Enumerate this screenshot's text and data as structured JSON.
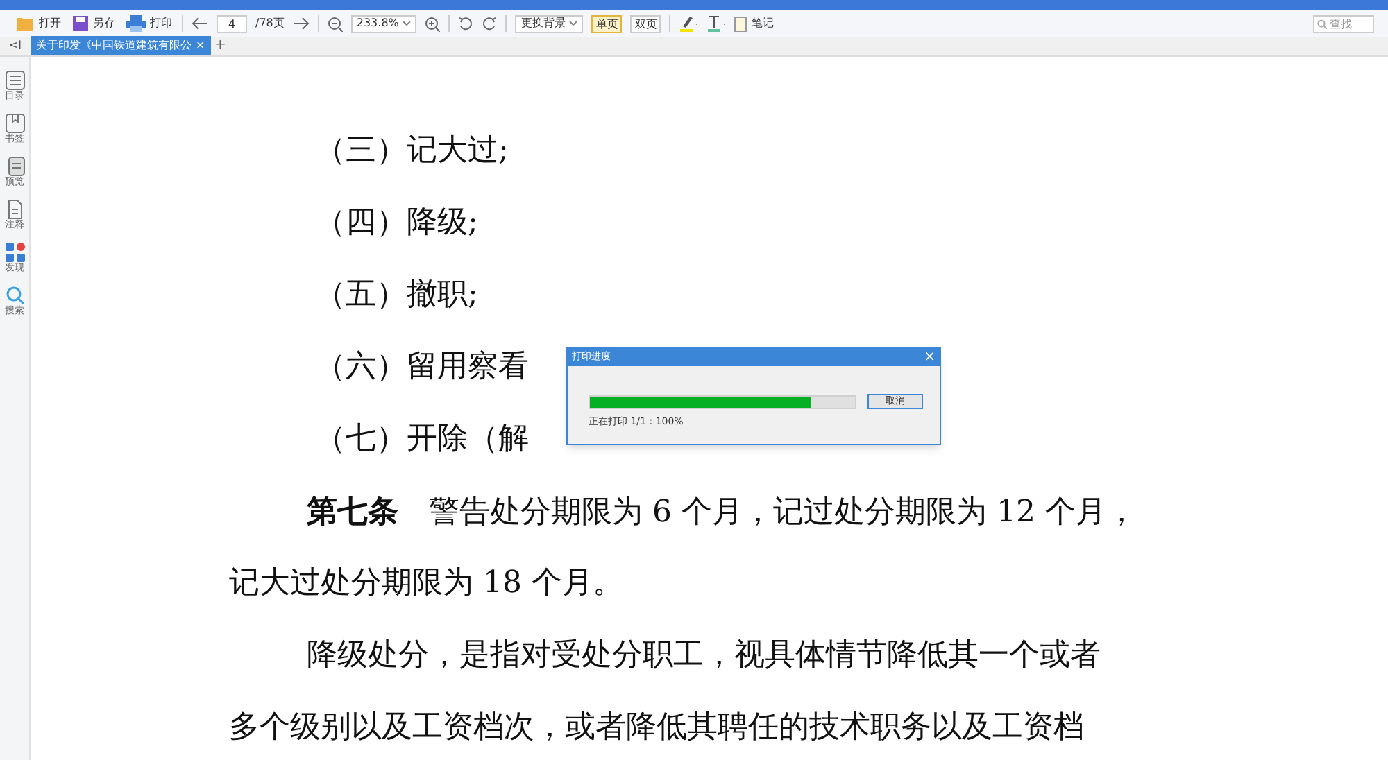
{
  "toolbar": {
    "items": [
      {
        "kind": "open",
        "label": "打开"
      },
      {
        "kind": "save",
        "label": "另存"
      },
      {
        "kind": "print",
        "label": "打印"
      }
    ],
    "page_input": "4",
    "page_total": "/78页",
    "zoom": "233.8%",
    "background": "更换背景",
    "view_modes": [
      {
        "label": "单页",
        "selected": true
      },
      {
        "label": "双页",
        "selected": false
      }
    ],
    "note": "笔记",
    "search": {
      "placeholder": "查找"
    }
  },
  "tabs": [
    {
      "label": "关于印发《中国铁道建筑有限公",
      "selected": true,
      "close": "×"
    }
  ],
  "new_tab": "+",
  "collapse": "<I",
  "sidebar": {
    "items": [
      {
        "kind": "toc",
        "label": "目录"
      },
      {
        "kind": "bookmark",
        "label": "书签"
      },
      {
        "kind": "preview",
        "label": "预览"
      },
      {
        "kind": "note",
        "label": "注释"
      },
      {
        "kind": "apps",
        "label": "发现"
      },
      {
        "kind": "search",
        "label": "搜索"
      }
    ]
  },
  "document": {
    "lines": [
      {
        "kind": "item",
        "text": "（三）记大过;"
      },
      {
        "kind": "item",
        "text": "（四）降级;"
      },
      {
        "kind": "item",
        "text": "（五）撤职;"
      },
      {
        "kind": "item",
        "text": "（六）留用察看"
      },
      {
        "kind": "item",
        "text": "（七）开除（解"
      },
      {
        "kind": "para",
        "text": "**第七条**　警告处分期限为 6 个月，记过处分期限为 12 个月，"
      },
      {
        "kind": "cont",
        "text": "记大过处分期限为 18 个月。"
      },
      {
        "kind": "para",
        "text": "降级处分，是指对受处分职工，视具体情节降低其一个或者"
      },
      {
        "kind": "cont",
        "text": "多个级别以及工资档次，或者降低其聘任的技术职务以及工资档"
      }
    ]
  },
  "dialog": {
    "title": "打印进度",
    "close": "×",
    "progress": {
      "level": 0.83
    },
    "cancel": "取消",
    "status": "正在打印 1/1 : 100%"
  }
}
